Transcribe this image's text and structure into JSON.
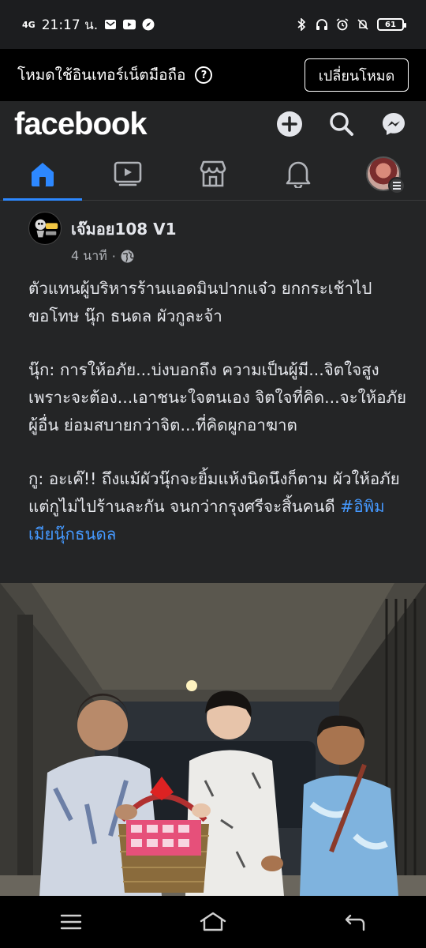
{
  "status_bar": {
    "network": "4G",
    "time": "21:17 น.",
    "battery": "61"
  },
  "mode_banner": {
    "text": "โหมดใช้อินเทอร์เน็ตมือถือ",
    "help_icon": "help-circle-icon",
    "button_label": "เปลี่ยนโหมด"
  },
  "header": {
    "logo": "facebook",
    "icons": [
      "plus-circle-icon",
      "search-icon",
      "messenger-icon"
    ]
  },
  "tabs": [
    {
      "name": "home",
      "icon": "home-icon",
      "active": true
    },
    {
      "name": "video",
      "icon": "video-icon",
      "active": false
    },
    {
      "name": "marketplace",
      "icon": "store-icon",
      "active": false
    },
    {
      "name": "notifications",
      "icon": "bell-icon",
      "active": false
    },
    {
      "name": "menu",
      "icon": "profile-avatar",
      "active": false
    }
  ],
  "post": {
    "author": "เจ๊มอย108 V1",
    "time": "4 นาที",
    "separator": "·",
    "privacy_icon": "globe-icon",
    "paragraphs": [
      "ตัวแทนผู้บริหารร้านแอดมินปากแจ๋ว ยกกระเช้าไปขอโทษ นุ๊ก ธนดล ผัวกูละจ้า",
      "นุ๊ก: การให้อภัย...บ่งบอกถึง ความเป็นผู้มี...จิตใจสูง\nเพราะจะต้อง...เอาชนะใจตนเอง จิตใจที่คิด...จะให้อภัยผู้อื่น ย่อมสบายกว่าจิต...ที่คิดผูกอาฆาต",
      "กู: อะเค๊!! ถึงแม้ผัวนุ๊กจะยิ้มแห้งนิดนึงก็ตาม ผัวให้อภัยแต่กูไม่ไปร้านละกัน จนกว่ากรุงศรีจะสิ้นคนดี"
    ],
    "hashtag": "#อิพิมเมียนุ๊กธนดล"
  },
  "colors": {
    "background": "#18191a",
    "surface": "#242526",
    "accent": "#2d88ff",
    "link": "#4599ff",
    "text_secondary": "#b0b3b8"
  },
  "nav_bar": {
    "icons": [
      "recent-apps-icon",
      "home-outline-icon",
      "back-icon"
    ]
  }
}
